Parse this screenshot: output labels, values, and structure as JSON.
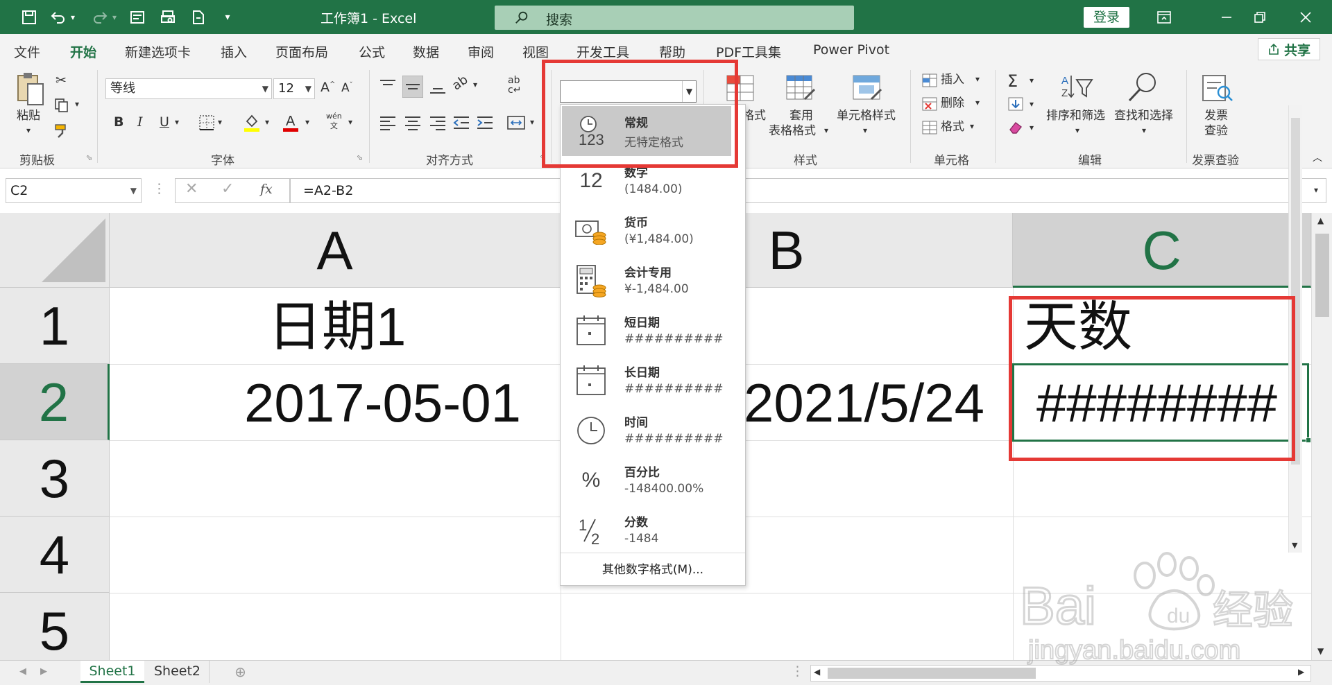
{
  "window": {
    "title": "工作簿1  -  Excel",
    "search_placeholder": "搜索",
    "login_label": "登录"
  },
  "menu": {
    "tabs": [
      "文件",
      "开始",
      "新建选项卡",
      "插入",
      "页面布局",
      "公式",
      "数据",
      "审阅",
      "视图",
      "开发工具",
      "帮助",
      "PDF工具集",
      "Power Pivot"
    ],
    "active_tab": "开始",
    "share_label": "共享"
  },
  "ribbon": {
    "clipboard": {
      "paste_label": "粘贴",
      "group_label": "剪贴板"
    },
    "font": {
      "font_name": "等线",
      "font_size": "12",
      "bold": "B",
      "italic": "I",
      "underline": "U",
      "group_label": "字体"
    },
    "alignment": {
      "group_label": "对齐方式"
    },
    "styles": {
      "format_partial": "格式",
      "table_format_line1": "套用",
      "table_format_line2": "表格格式",
      "cell_styles": "单元格样式",
      "group_label": "样式"
    },
    "cells": {
      "insert": "插入",
      "delete": "删除",
      "format": "格式",
      "group_label": "单元格"
    },
    "editing": {
      "sort_filter": "排序和筛选",
      "find_select": "查找和选择",
      "group_label": "编辑"
    },
    "invoice": {
      "check_line1": "发票",
      "check_line2": "查验",
      "group_label": "发票查验"
    }
  },
  "formula_bar": {
    "name_box": "C2",
    "formula": "=A2-B2"
  },
  "grid": {
    "columns": [
      "A",
      "B",
      "C"
    ],
    "selected_column": "C",
    "rows": [
      "1",
      "2",
      "3",
      "4",
      "5"
    ],
    "selected_row": "2",
    "cells": {
      "A1": "日期1",
      "A2": "2017-05-01",
      "B2": "2021/5/24",
      "C1": "天数",
      "C2": "########"
    }
  },
  "sheets": {
    "tabs": [
      "Sheet1",
      "Sheet2"
    ],
    "active": "Sheet1"
  },
  "number_format_dropdown": {
    "current_value": "",
    "items": [
      {
        "name": "常规",
        "sample": "无特定格式",
        "icon": "clock-123-icon",
        "selected": true
      },
      {
        "name": "数字",
        "sample": "(1484.00)",
        "icon": "number-12-icon"
      },
      {
        "name": "货币",
        "sample": "(¥1,484.00)",
        "icon": "currency-icon"
      },
      {
        "name": "会计专用",
        "sample": " ¥-1,484.00",
        "icon": "calculator-icon"
      },
      {
        "name": "短日期",
        "sample": "##########",
        "icon": "calendar-icon"
      },
      {
        "name": "长日期",
        "sample": "##########",
        "icon": "calendar-icon"
      },
      {
        "name": "时间",
        "sample": "##########",
        "icon": "clock-icon"
      },
      {
        "name": "百分比",
        "sample": "-148400.00%",
        "icon": "percent-icon"
      },
      {
        "name": "分数",
        "sample": "-1484",
        "icon": "fraction-icon"
      }
    ],
    "more_formats": "其他数字格式(M)..."
  },
  "colors": {
    "excel_green": "#217346",
    "highlight_red": "#e53935"
  }
}
